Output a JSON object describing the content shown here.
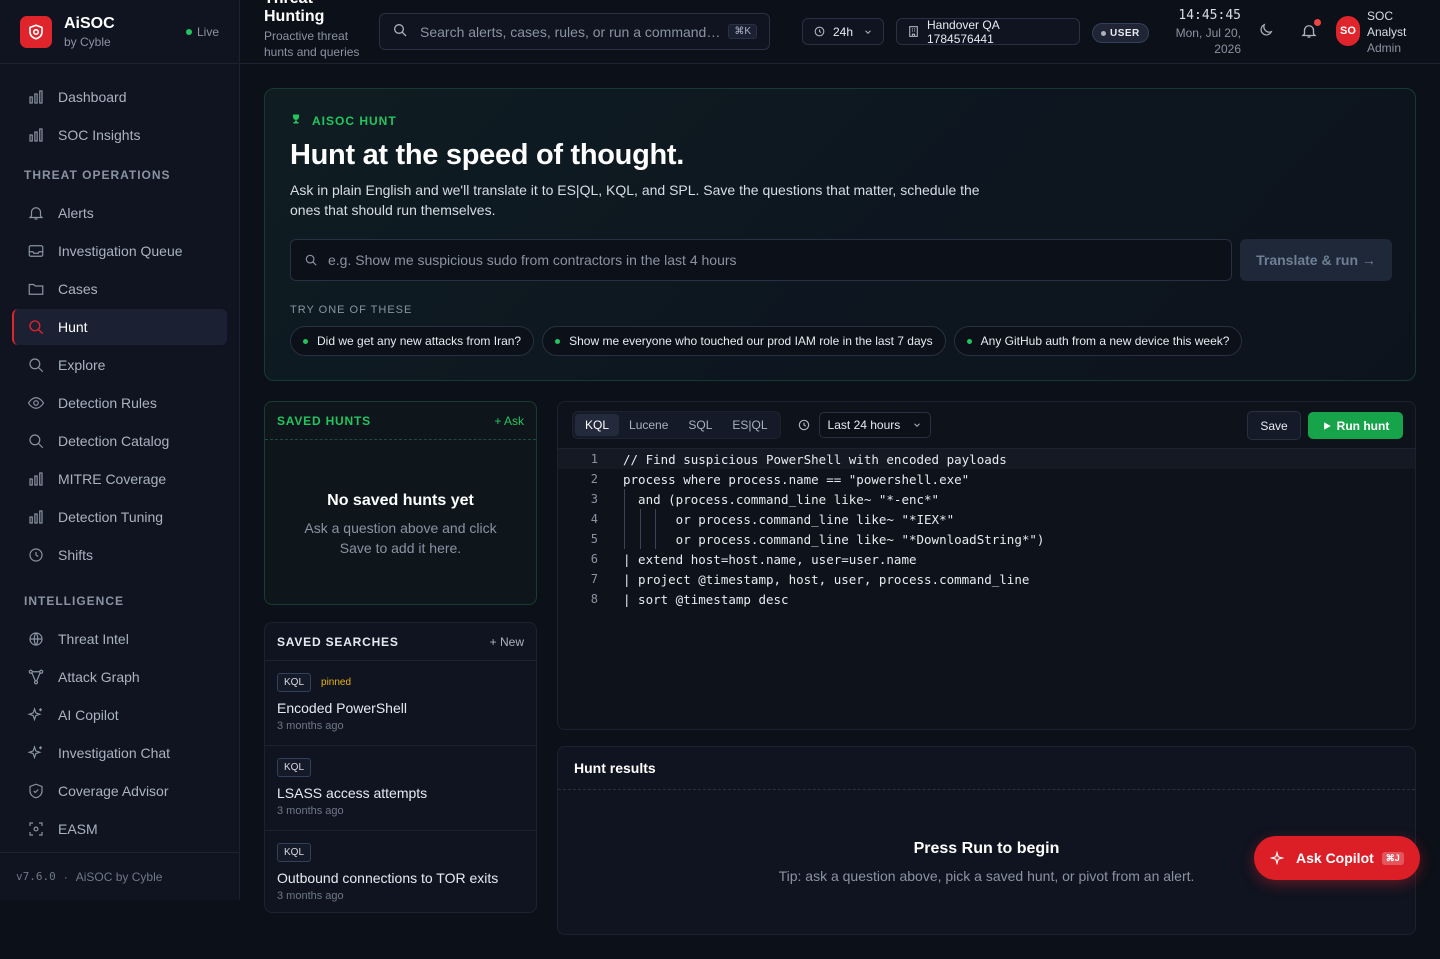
{
  "brand": {
    "name": "AiSOC",
    "sub": "by Cyble",
    "status": "Live"
  },
  "nav": {
    "top": [
      {
        "label": "Dashboard",
        "icon": "bar-chart-icon"
      },
      {
        "label": "SOC Insights",
        "icon": "bar-chart-icon"
      }
    ],
    "section_threat": "THREAT OPERATIONS",
    "threat": [
      {
        "label": "Alerts",
        "icon": "bell-icon"
      },
      {
        "label": "Investigation Queue",
        "icon": "inbox-icon"
      },
      {
        "label": "Cases",
        "icon": "folder-icon"
      },
      {
        "label": "Hunt",
        "icon": "search-icon",
        "active": true
      },
      {
        "label": "Explore",
        "icon": "search-icon"
      },
      {
        "label": "Detection Rules",
        "icon": "eye-icon"
      },
      {
        "label": "Detection Catalog",
        "icon": "search-icon"
      },
      {
        "label": "MITRE Coverage",
        "icon": "bar-chart-icon"
      },
      {
        "label": "Detection Tuning",
        "icon": "bar-chart-icon"
      },
      {
        "label": "Shifts",
        "icon": "clock-icon"
      }
    ],
    "section_intel": "INTELLIGENCE",
    "intel": [
      {
        "label": "Threat Intel",
        "icon": "globe-icon"
      },
      {
        "label": "Attack Graph",
        "icon": "graph-icon"
      },
      {
        "label": "AI Copilot",
        "icon": "sparkle-icon"
      },
      {
        "label": "Investigation Chat",
        "icon": "sparkle-icon"
      },
      {
        "label": "Coverage Advisor",
        "icon": "shield-icon"
      },
      {
        "label": "EASM",
        "icon": "scan-icon"
      }
    ]
  },
  "footer": {
    "version": "v7.6.0",
    "separator": "·",
    "company": "AiSOC by Cyble"
  },
  "topbar": {
    "title": "Threat Hunting",
    "subtitle": "Proactive threat hunts and queries",
    "search_placeholder": "Search alerts, cases, rules, or run a command…",
    "search_shortcut": "⌘K",
    "range": "24h",
    "workspace": "Handover QA 1784576441",
    "role_badge": "USER",
    "time": "14:45:45",
    "date": "Mon, Jul 20, 2026",
    "user_initials": "SO",
    "user_name": "SOC Analyst",
    "user_role": "Admin"
  },
  "hero": {
    "eyebrow": "AISOC HUNT",
    "title": "Hunt at the speed of thought.",
    "description": "Ask in plain English and we'll translate it to ES|QL, KQL, and SPL. Save the questions that matter, schedule the ones that should run themselves.",
    "input_placeholder": "e.g. Show me suspicious sudo from contractors in the last 4 hours",
    "translate_label": "Translate & run →",
    "try_label": "TRY ONE OF THESE",
    "suggestions": [
      "Did we get any new attacks from Iran?",
      "Show me everyone who touched our prod IAM role in the last 7 days",
      "Any GitHub auth from a new device this week?"
    ]
  },
  "saved_hunts": {
    "title": "SAVED HUNTS",
    "action": "+ Ask",
    "empty_title": "No saved hunts yet",
    "empty_text": "Ask a question above and click Save to add it here."
  },
  "saved_searches": {
    "title": "SAVED SEARCHES",
    "action": "+ New",
    "items": [
      {
        "lang": "KQL",
        "pinned": "pinned",
        "name": "Encoded PowerShell",
        "time": "3 months ago"
      },
      {
        "lang": "KQL",
        "pinned": "",
        "name": "LSASS access attempts",
        "time": "3 months ago"
      },
      {
        "lang": "KQL",
        "pinned": "",
        "name": "Outbound connections to TOR exits",
        "time": "3 months ago"
      }
    ]
  },
  "editor": {
    "tabs": [
      "KQL",
      "Lucene",
      "SQL",
      "ES|QL"
    ],
    "active_tab": "KQL",
    "range": "Last 24 hours",
    "save_label": "Save",
    "run_label": "Run hunt",
    "lines": [
      "// Find suspicious PowerShell with encoded payloads",
      "process where process.name == \"powershell.exe\"",
      "  and (process.command_line like~ \"*-enc*\"",
      "       or process.command_line like~ \"*IEX*\"",
      "       or process.command_line like~ \"*DownloadString*\")",
      "| extend host=host.name, user=user.name",
      "| project @timestamp, host, user, process.command_line",
      "| sort @timestamp desc"
    ]
  },
  "results": {
    "title": "Hunt results",
    "empty_title": "Press Run to begin",
    "empty_text": "Tip: ask a question above, pick a saved hunt, or pivot from an alert."
  },
  "copilot": {
    "label": "Ask Copilot",
    "shortcut": "⌘J"
  },
  "colors": {
    "accent": "#e0242c",
    "success": "#22c55e",
    "run": "#16a34a",
    "background": "#0c1018"
  }
}
